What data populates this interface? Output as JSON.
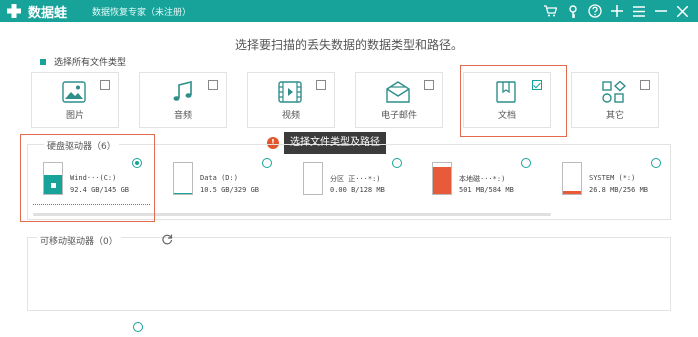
{
  "titlebar": {
    "app_name": "数据蛙",
    "app_subtitle": "数据恢复专家（未注册）",
    "icons": [
      "cart-icon",
      "key-icon",
      "help-icon",
      "plus-icon",
      "menu-icon",
      "minimize-icon",
      "close-icon"
    ]
  },
  "heading": "选择要扫描的丢失数据的数据类型和路径。",
  "select_all_label": "选择所有文件类型",
  "file_types": [
    {
      "label": "图片",
      "icon": "image-icon",
      "checked": false
    },
    {
      "label": "音频",
      "icon": "audio-icon",
      "checked": false
    },
    {
      "label": "视频",
      "icon": "video-icon",
      "checked": false
    },
    {
      "label": "电子邮件",
      "icon": "email-icon",
      "checked": false
    },
    {
      "label": "文档",
      "icon": "document-icon",
      "checked": true
    },
    {
      "label": "其它",
      "icon": "other-icon",
      "checked": false
    }
  ],
  "tooltip": {
    "badge": "!",
    "text": "选择文件类型及路径"
  },
  "hard_drives": {
    "title": "硬盘驱动器（6）",
    "items": [
      {
        "name": "Wind···(C:)",
        "size": "92.4 GB/145 GB",
        "selected": true,
        "fill_fraction": 0.6,
        "color": "#17a39a"
      },
      {
        "name": "Data (D:)",
        "size": "10.5 GB/329 GB",
        "selected": false,
        "fill_fraction": 0.04,
        "color": "#17a39a"
      },
      {
        "name": "分区 正···*:)",
        "size": "0.00  B/128 MB",
        "selected": false,
        "fill_fraction": 0.0,
        "color": "#e85b3a"
      },
      {
        "name": "本地磁···*:)",
        "size": "501 MB/584 MB",
        "selected": false,
        "fill_fraction": 0.86,
        "color": "#e85b3a"
      },
      {
        "name": "SYSTEM (*:)",
        "size": "26.8 MB/256 MB",
        "selected": false,
        "fill_fraction": 0.1,
        "color": "#e85b3a"
      }
    ]
  },
  "removable_drives": {
    "title": "可移动驱动器（0）"
  }
}
